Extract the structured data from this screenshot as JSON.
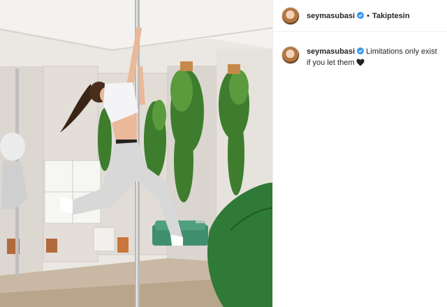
{
  "post": {
    "username": "seymasubasi",
    "follow_status": "Takiptesin",
    "separator": "•",
    "caption": "Limitations only exist if you let them",
    "caption_emoji": "black-heart-icon",
    "verified_icon": "verified-badge-icon"
  },
  "colors": {
    "verified": "#3897f0",
    "text": "#262626",
    "border": "#efefef"
  }
}
